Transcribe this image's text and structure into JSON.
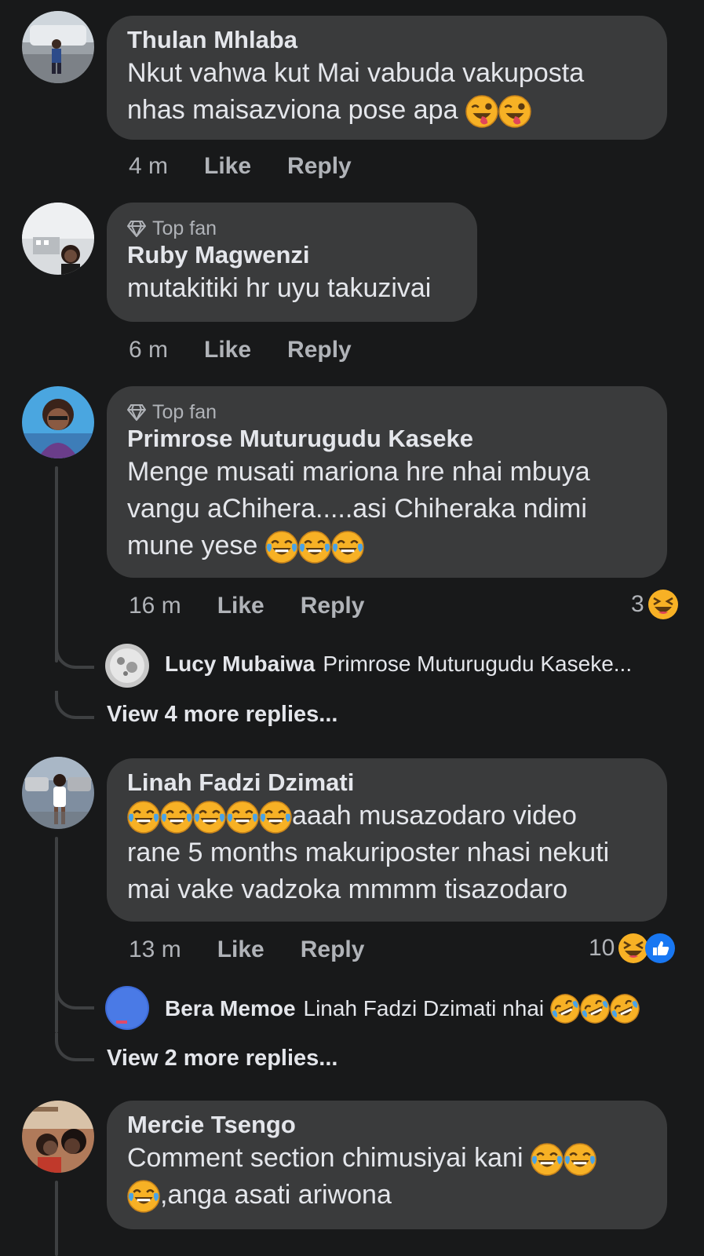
{
  "comments": [
    {
      "author": "Thulan Mhlaba",
      "line1": "Nkut vahwa kut Mai vabuda vakuposta",
      "line2": "nhas maisazviona pose apa",
      "time": "4 m",
      "like": "Like",
      "reply": "Reply"
    },
    {
      "badge": "Top fan",
      "author": "Ruby Magwenzi",
      "line1": "mutakitiki hr uyu takuzivai",
      "time": "6 m",
      "like": "Like",
      "reply": "Reply"
    },
    {
      "badge": "Top fan",
      "author": "Primrose Muturugudu Kaseke",
      "line1": "Menge musati mariona hre nhai mbuya",
      "line2": "vangu aChihera.....asi Chiheraka ndimi",
      "line3": "mune yese",
      "time": "16 m",
      "like": "Like",
      "reply": "Reply",
      "reaction_count": "3",
      "reply_preview": {
        "name": "Lucy Mubaiwa",
        "text": "Primrose Muturugudu Kaseke..."
      },
      "more_replies": "View 4 more replies..."
    },
    {
      "author": "Linah Fadzi Dzimati",
      "line1": "aaah musazodaro video",
      "line2": "rane 5 months makuriposter nhasi nekuti",
      "line3": "mai vake vadzoka mmmm tisazodaro",
      "time": "13 m",
      "like": "Like",
      "reply": "Reply",
      "reaction_count": "10",
      "reply_preview": {
        "name": "Bera Memoe",
        "text": "Linah Fadzi Dzimati nhai"
      },
      "more_replies": "View 2 more replies..."
    },
    {
      "author": "Mercie Tsengo",
      "line1": "Comment section chimusiyai kani",
      "line2": ",anga asati ariwona"
    }
  ],
  "colors": {
    "background": "#18191a",
    "bubble": "#3a3b3c",
    "text": "#e4e6eb",
    "secondary": "#b0b3b8",
    "like_blue": "#1877f2",
    "emoji_yellow": "#f7b125"
  },
  "icons": [
    "diamond-icon",
    "winking-tongue-emoji",
    "tears-of-joy-emoji",
    "rolling-laugh-emoji",
    "haha-reaction-icon",
    "like-reaction-icon"
  ]
}
